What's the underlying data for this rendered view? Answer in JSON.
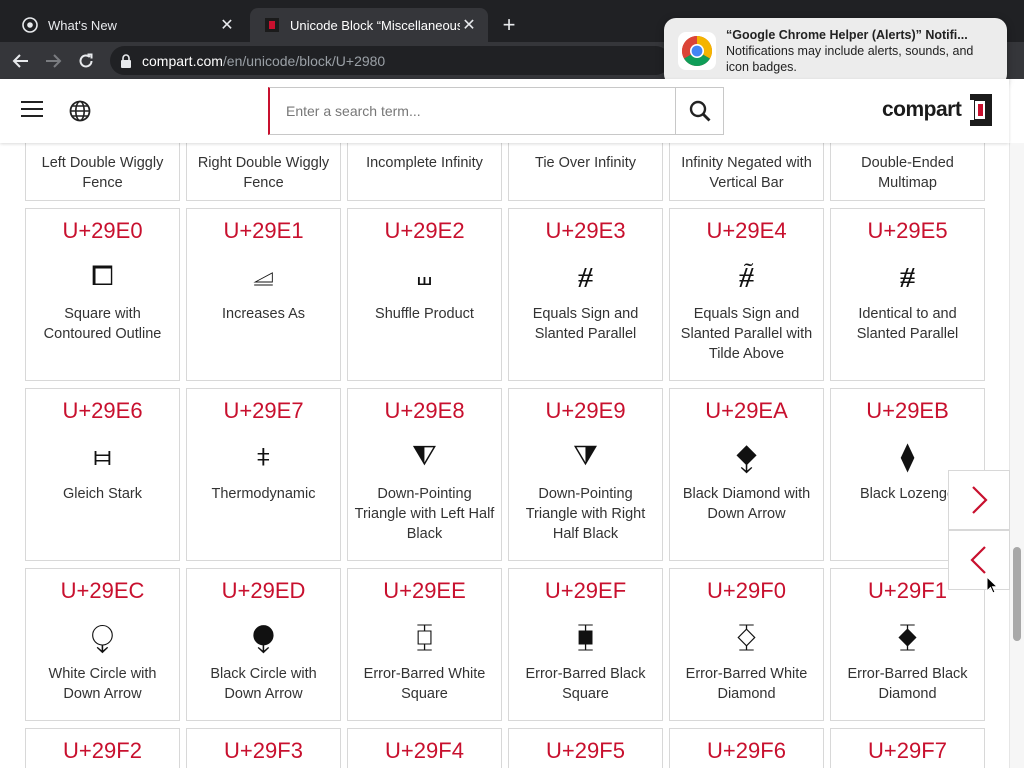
{
  "browser": {
    "tabs": [
      {
        "title": "What's New"
      },
      {
        "title": "Unicode Block “Miscellaneous"
      }
    ],
    "url_host": "compart.com",
    "url_path": "/en/unicode/block/U+2980"
  },
  "notification": {
    "title": "“Google Chrome Helper (Alerts)” Notifi...",
    "body": "Notifications may include alerts, sounds, and icon badges."
  },
  "header": {
    "search_placeholder": "Enter a search term...",
    "logo_text": "compart"
  },
  "top_row_names": [
    "Left Double Wiggly Fence",
    "Right Double Wiggly Fence",
    "Incomplete Infinity",
    "Tie Over Infinity",
    "Infinity Negated with Vertical Bar",
    "Double-Ended Multimap"
  ],
  "rows": [
    [
      {
        "code": "U+29E0",
        "glyph": "⧠",
        "name": "Square with Contoured Outline"
      },
      {
        "code": "U+29E1",
        "glyph": "⧡",
        "name": "Increases As"
      },
      {
        "code": "U+29E2",
        "glyph": "⧢",
        "name": "Shuffle Product"
      },
      {
        "code": "U+29E3",
        "glyph": "⧣",
        "name": "Equals Sign and Slanted Parallel"
      },
      {
        "code": "U+29E4",
        "glyph": "⧤",
        "name": "Equals Sign and Slanted Parallel with Tilde Above"
      },
      {
        "code": "U+29E5",
        "glyph": "⧥",
        "name": "Identical to and Slanted Parallel"
      }
    ],
    [
      {
        "code": "U+29E6",
        "glyph": "⧦",
        "name": "Gleich Stark"
      },
      {
        "code": "U+29E7",
        "glyph": "⧧",
        "name": "Thermodynamic"
      },
      {
        "code": "U+29E8",
        "glyph": "⧨",
        "name": "Down-Pointing Triangle with Left Half Black"
      },
      {
        "code": "U+29E9",
        "glyph": "⧩",
        "name": "Down-Pointing Triangle with Right Half Black"
      },
      {
        "code": "U+29EA",
        "glyph": "⧪",
        "name": "Black Diamond with Down Arrow"
      },
      {
        "code": "U+29EB",
        "glyph": "⧫",
        "name": "Black Lozenge"
      }
    ],
    [
      {
        "code": "U+29EC",
        "glyph": "⧬",
        "name": "White Circle with Down Arrow"
      },
      {
        "code": "U+29ED",
        "glyph": "⧭",
        "name": "Black Circle with Down Arrow"
      },
      {
        "code": "U+29EE",
        "glyph": "⧮",
        "name": "Error-Barred White Square"
      },
      {
        "code": "U+29EF",
        "glyph": "⧯",
        "name": "Error-Barred Black Square"
      },
      {
        "code": "U+29F0",
        "glyph": "⧰",
        "name": "Error-Barred White Diamond"
      },
      {
        "code": "U+29F1",
        "glyph": "⧱",
        "name": "Error-Barred Black Diamond"
      }
    ],
    [
      {
        "code": "U+29F2",
        "glyph": "",
        "name": ""
      },
      {
        "code": "U+29F3",
        "glyph": "",
        "name": ""
      },
      {
        "code": "U+29F4",
        "glyph": "",
        "name": ""
      },
      {
        "code": "U+29F5",
        "glyph": "",
        "name": ""
      },
      {
        "code": "U+29F6",
        "glyph": "",
        "name": ""
      },
      {
        "code": "U+29F7",
        "glyph": "",
        "name": ""
      }
    ]
  ],
  "colors": {
    "accent": "#c8102e",
    "chrome_dark": "#202124",
    "chrome_toolbar": "#35363a"
  }
}
